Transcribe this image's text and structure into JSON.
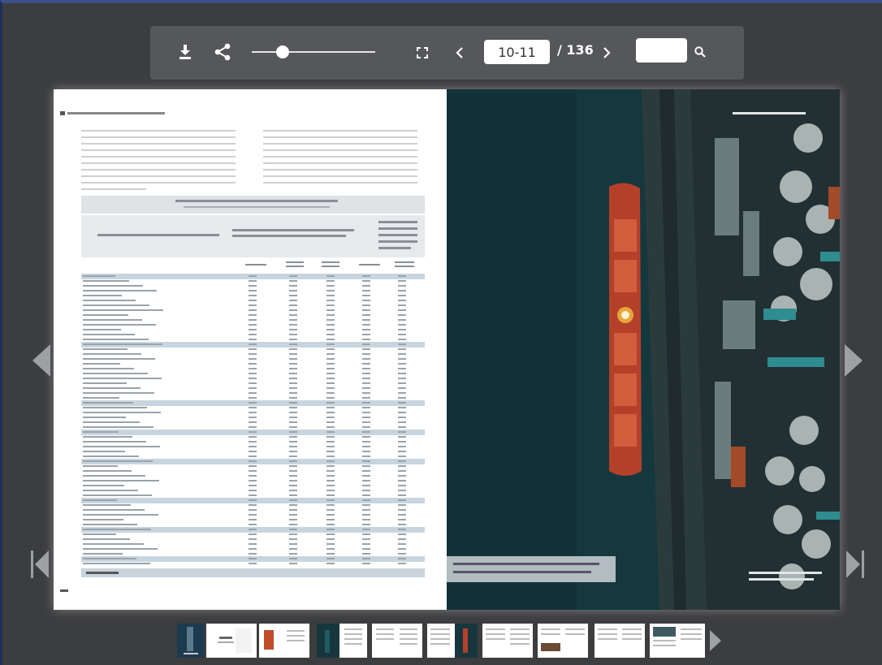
{
  "toolbar": {
    "download_icon": "download-icon",
    "share_icon": "share-icon",
    "zoom_level": 0.25,
    "fullscreen_icon": "fullscreen-icon",
    "prev_icon": "chevron-left-icon",
    "next_icon": "chevron-right-icon",
    "current_page": "10-11",
    "total_pages": "/ 136",
    "search_value": "",
    "search_icon": "search-icon"
  },
  "colors": {
    "background": "#3c3d3f",
    "toolbar": "#56575a",
    "accent_border": "#3b4f8a",
    "right_page_water": "#16393f"
  },
  "navigation": {
    "prev_page_icon": "triangle-left-icon",
    "next_page_icon": "triangle-right-icon",
    "first_page_icon": "first-page-icon",
    "last_page_icon": "last-page-icon",
    "thumbs_next_icon": "triangle-right-icon"
  },
  "thumbnails": {
    "count": 10
  }
}
